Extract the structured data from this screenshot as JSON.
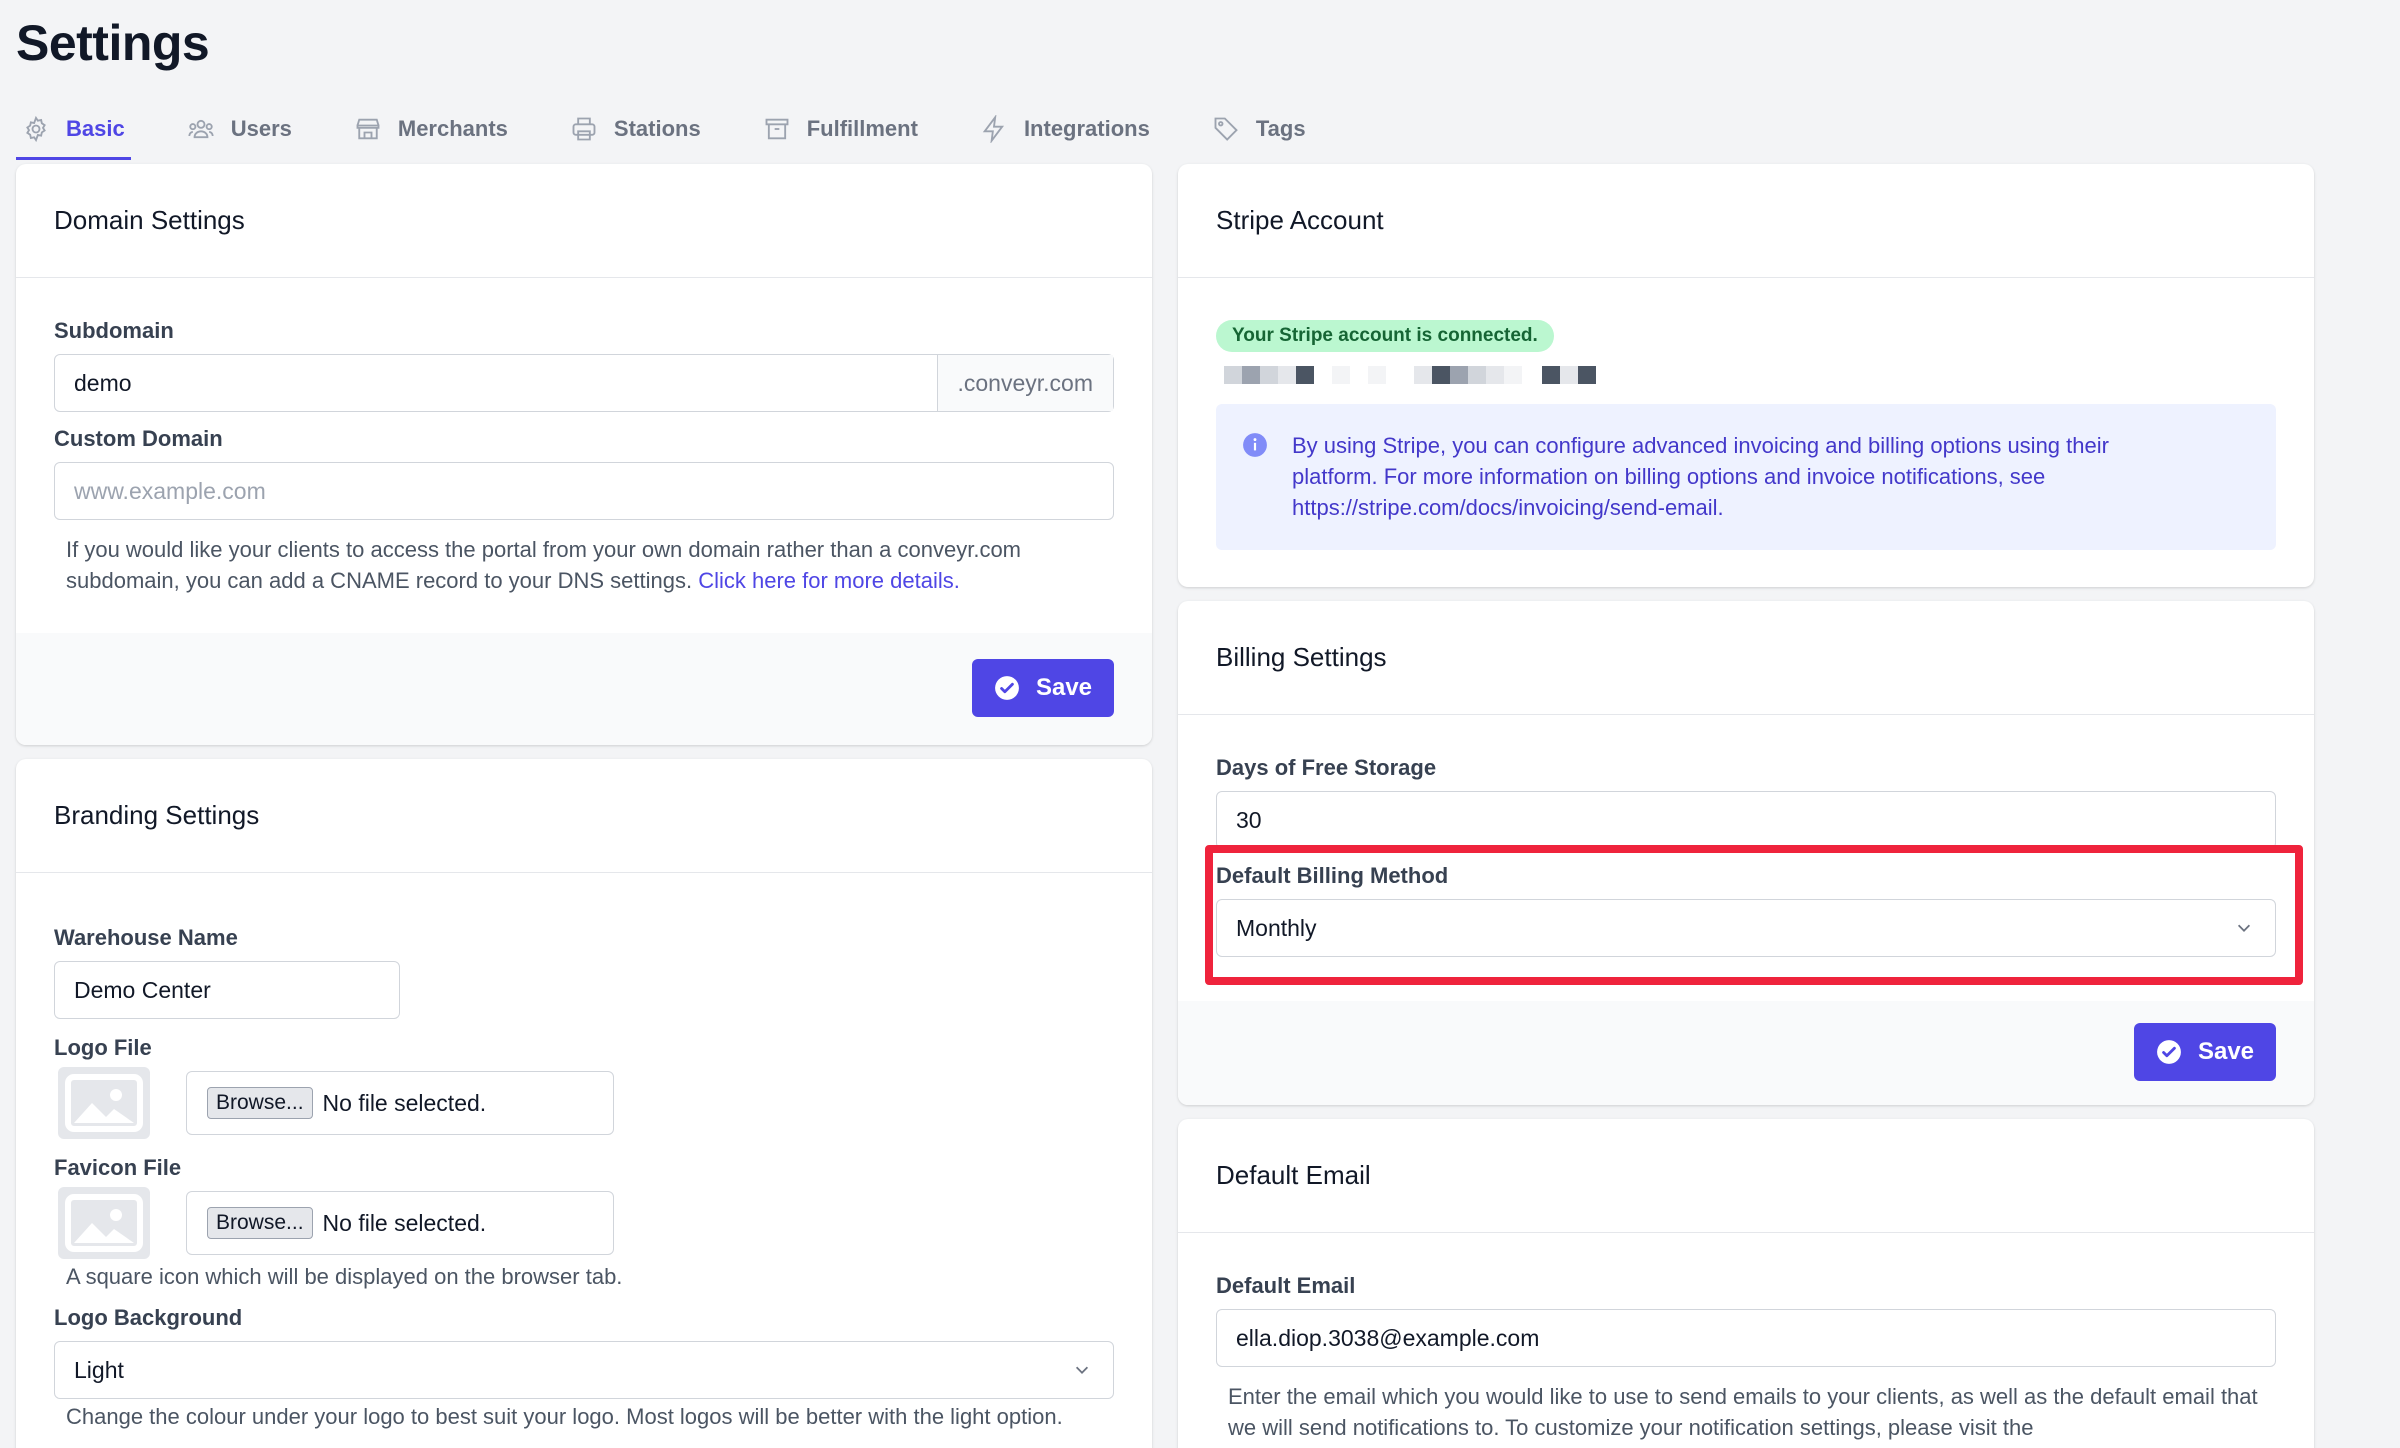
{
  "page": {
    "title": "Settings"
  },
  "tabs": [
    {
      "label": "Basic",
      "icon": "gear-icon",
      "active": true
    },
    {
      "label": "Users",
      "icon": "users-icon"
    },
    {
      "label": "Merchants",
      "icon": "store-icon"
    },
    {
      "label": "Stations",
      "icon": "printer-icon"
    },
    {
      "label": "Fulfillment",
      "icon": "archive-box-icon"
    },
    {
      "label": "Integrations",
      "icon": "bolt-icon"
    },
    {
      "label": "Tags",
      "icon": "tag-icon"
    }
  ],
  "domain": {
    "title": "Domain Settings",
    "subdomain_label": "Subdomain",
    "subdomain_value": "demo",
    "subdomain_suffix": ".conveyr.com",
    "custom_domain_label": "Custom Domain",
    "custom_domain_placeholder": "www.example.com",
    "help_text": "If you would like your clients to access the portal from your own domain rather than a conveyr.com subdomain, you can add a CNAME record to your DNS settings.",
    "help_link": "Click here for more details.",
    "save_label": "Save"
  },
  "branding": {
    "title": "Branding Settings",
    "warehouse_label": "Warehouse Name",
    "warehouse_value": "Demo Center",
    "logo_label": "Logo File",
    "favicon_label": "Favicon File",
    "browse_label": "Browse...",
    "no_file": "No file selected.",
    "favicon_help": "A square icon which will be displayed on the browser tab.",
    "background_label": "Logo Background",
    "background_value": "Light",
    "background_help": "Change the colour under your logo to best suit your logo. Most logos will be better with the light option."
  },
  "stripe": {
    "title": "Stripe Account",
    "badge": "Your Stripe account is connected.",
    "info_text": "By using Stripe, you can configure advanced invoicing and billing options using their platform. For more information on billing options and invoice notifications, see",
    "info_link": "https://stripe.com/docs/invoicing/send-email",
    "info_end": "."
  },
  "billing": {
    "title": "Billing Settings",
    "storage_label": "Days of Free Storage",
    "storage_value": "30",
    "method_label": "Default Billing Method",
    "method_value": "Monthly",
    "save_label": "Save"
  },
  "email": {
    "title": "Default Email",
    "label": "Default Email",
    "value": "ella.diop.3038@example.com",
    "help_text": "Enter the email which you would like to use to send emails to your clients, as well as the default email that we will send notifications to. To customize your notification settings, please visit the"
  },
  "colors": {
    "accent": "#4f46e5",
    "highlight": "#ef233c",
    "success_bg": "#bbf7d0"
  }
}
